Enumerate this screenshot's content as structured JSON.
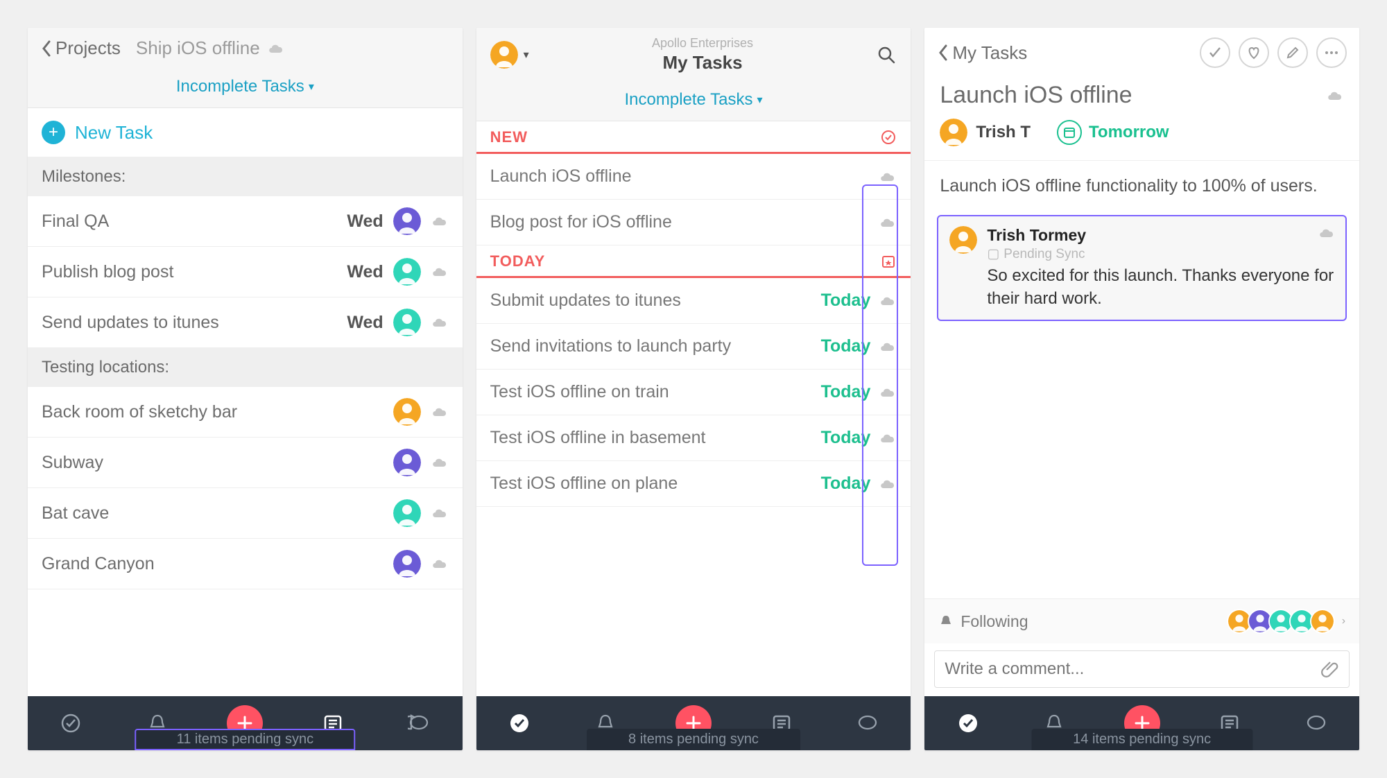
{
  "colors": {
    "accent_teal": "#1fb3d6",
    "accent_green": "#19c08f",
    "accent_coral": "#f25d5d",
    "accent_add": "#ff5263",
    "highlight_purple": "#7b61ff",
    "avatar_orange": "#f5a623",
    "avatar_purple": "#6b5bd6",
    "avatar_teal": "#2fd6b8"
  },
  "panel1": {
    "back_label": "Projects",
    "title": "Ship iOS offline",
    "filter_label": "Incomplete Tasks",
    "new_task_label": "New Task",
    "sections": [
      {
        "header": "Milestones:",
        "tasks": [
          {
            "name": "Final QA",
            "due": "Wed",
            "avatar_color": "#6b5bd6"
          },
          {
            "name": "Publish blog post",
            "due": "Wed",
            "avatar_color": "#2fd6b8"
          },
          {
            "name": "Send updates to itunes",
            "due": "Wed",
            "avatar_color": "#2fd6b8"
          }
        ]
      },
      {
        "header": "Testing locations:",
        "tasks": [
          {
            "name": "Back room of sketchy bar",
            "due": "",
            "avatar_color": "#f5a623"
          },
          {
            "name": "Subway",
            "due": "",
            "avatar_color": "#6b5bd6"
          },
          {
            "name": "Bat cave",
            "due": "",
            "avatar_color": "#2fd6b8"
          },
          {
            "name": "Grand Canyon",
            "due": "",
            "avatar_color": "#6b5bd6"
          }
        ]
      }
    ],
    "sync_status": "11 items pending sync"
  },
  "panel2": {
    "org": "Apollo Enterprises",
    "title": "My Tasks",
    "filter_label": "Incomplete Tasks",
    "avatar_color": "#f5a623",
    "groups": [
      {
        "label": "NEW",
        "icon": "check-badge",
        "tasks": [
          {
            "name": "Launch iOS offline",
            "due": ""
          },
          {
            "name": "Blog post for iOS offline",
            "due": ""
          }
        ]
      },
      {
        "label": "TODAY",
        "icon": "calendar-star",
        "tasks": [
          {
            "name": "Submit updates to itunes",
            "due": "Today"
          },
          {
            "name": "Send invitations to launch party",
            "due": "Today"
          },
          {
            "name": "Test iOS offline on train",
            "due": "Today"
          },
          {
            "name": "Test iOS offline in basement",
            "due": "Today"
          },
          {
            "name": "Test iOS offline on plane",
            "due": "Today"
          }
        ]
      }
    ],
    "sync_status": "8 items pending sync"
  },
  "panel3": {
    "back_label": "My Tasks",
    "actions": [
      "complete",
      "like",
      "edit",
      "more"
    ],
    "task_title": "Launch iOS offline",
    "assignee": {
      "name": "Trish T",
      "avatar_color": "#f5a623"
    },
    "due_label": "Tomorrow",
    "description": "Launch iOS offline functionality to 100% of users.",
    "comment": {
      "author": "Trish Tormey",
      "avatar_color": "#f5a623",
      "sync_state": "Pending Sync",
      "text": "So excited for this launch. Thanks everyone for their hard work."
    },
    "following_label": "Following",
    "followers": [
      "#f5a623",
      "#6b5bd6",
      "#2fd6b8",
      "#2fd6b8",
      "#f5a623"
    ],
    "comment_placeholder": "Write a comment...",
    "sync_status": "14 items pending sync"
  }
}
